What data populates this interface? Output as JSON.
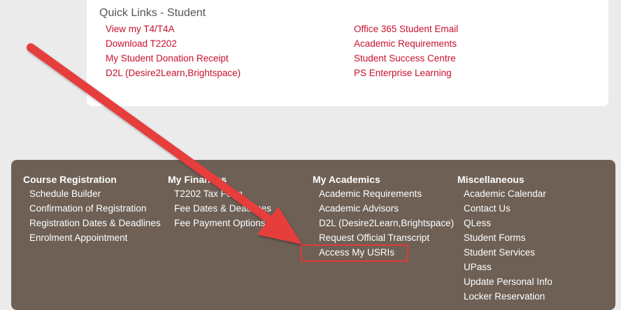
{
  "quick_links": {
    "title": "Quick Links - Student",
    "left": [
      "View my T4/T4A",
      "Download T2202",
      "My Student Donation Receipt",
      "D2L (Desire2Learn,Brightspace)"
    ],
    "right": [
      "Office 365 Student Email",
      "Academic Requirements",
      "Student Success Centre",
      "PS Enterprise Learning"
    ]
  },
  "footer": {
    "course_registration": {
      "heading": "Course Registration",
      "links": [
        "Schedule Builder",
        "Confirmation of Registration",
        "Registration Dates & Deadlines",
        "Enrolment Appointment"
      ]
    },
    "my_finances": {
      "heading": "My Finances",
      "links": [
        "T2202 Tax Form",
        "Fee Dates & Deadlines",
        "Fee Payment Options"
      ]
    },
    "my_academics": {
      "heading": "My Academics",
      "links": [
        "Academic Requirements",
        "Academic Advisors",
        "D2L (Desire2Learn,Brightspace)",
        "Request Official Transcript",
        "Access My USRIs"
      ]
    },
    "miscellaneous": {
      "heading": "Miscellaneous",
      "links": [
        "Academic Calendar",
        "Contact Us",
        "QLess",
        "Student Forms",
        "Student Services",
        "UPass",
        "Update Personal Info",
        "Locker Reservation"
      ]
    }
  },
  "colors": {
    "link_red": "#c8102e",
    "footer_bg": "#6e6055",
    "annotation_red": "#e03a3a"
  }
}
